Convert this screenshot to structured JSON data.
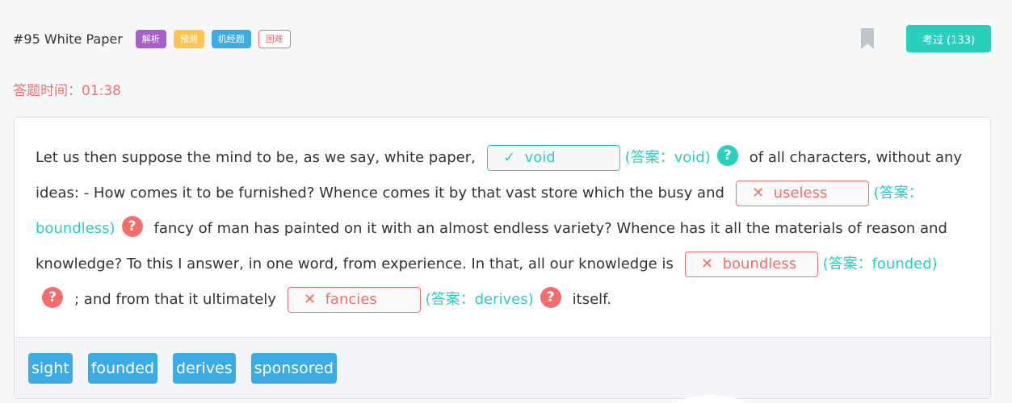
{
  "header": {
    "title": "#95 White Paper",
    "tags": [
      "解析",
      "预测",
      "机经题",
      "困难"
    ],
    "exam_button": "考过 (133)"
  },
  "timer": "答题时间：01:38",
  "passage": {
    "seg1": "Let us then suppose the mind to be, as we say, white paper,",
    "blank1": {
      "value": "void",
      "status": "correct",
      "answer": "(答案：void)"
    },
    "seg2": "of all characters, without any ideas: - How comes it to be furnished? Whence comes it by that vast store which the busy and",
    "blank2": {
      "value": "useless",
      "status": "wrong",
      "answer": "(答案：boundless)"
    },
    "seg3": "fancy of man has painted on it with an almost endless variety? Whence has it all the materials of reason and knowledge? To this I answer, in one word, from experience. In that, all our knowledge is",
    "blank3": {
      "value": "boundless",
      "status": "wrong",
      "answer": "(答案：founded)"
    },
    "seg4": "; and from that it ultimately",
    "blank4": {
      "value": "fancies",
      "status": "wrong",
      "answer": "(答案：derives)"
    },
    "seg5": "itself."
  },
  "marks": {
    "correct": "✓",
    "wrong": "✕",
    "help": "?"
  },
  "word_bank": [
    "sight",
    "founded",
    "derives",
    "sponsored"
  ],
  "colors": {
    "accent_teal": "#2bcfbd",
    "error_red": "#f56c6c",
    "tag_purple": "#a85fc9",
    "tag_yellow": "#fdc453",
    "tag_blue": "#3dabe3"
  }
}
